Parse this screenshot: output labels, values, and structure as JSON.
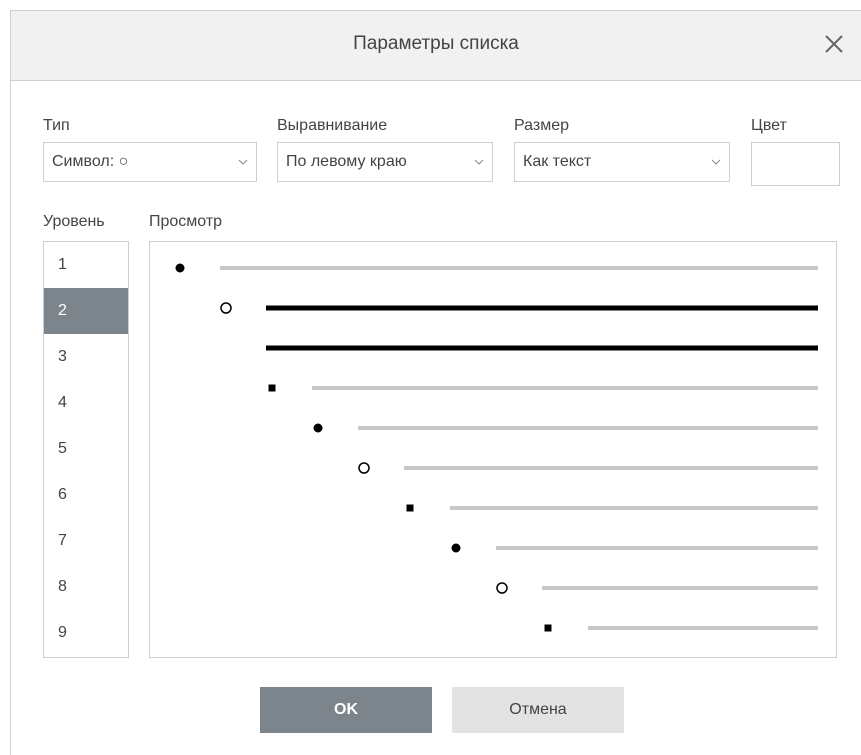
{
  "dialog": {
    "title": "Параметры списка"
  },
  "fields": {
    "type": {
      "label": "Тип",
      "value": "Символ: ○"
    },
    "alignment": {
      "label": "Выравнивание",
      "value": "По левому краю"
    },
    "size": {
      "label": "Размер",
      "value": "Как текст"
    },
    "color": {
      "label": "Цвет",
      "value": ""
    }
  },
  "levels": {
    "label": "Уровень",
    "items": [
      "1",
      "2",
      "3",
      "4",
      "5",
      "6",
      "7",
      "8",
      "9"
    ],
    "selected": "2"
  },
  "preview": {
    "label": "Просмотр",
    "bullets": [
      "filled-circle",
      "hollow-circle",
      "filled-square",
      "filled-circle",
      "hollow-circle",
      "filled-square",
      "filled-circle",
      "hollow-circle",
      "filled-square"
    ],
    "highlighted_level": 2
  },
  "buttons": {
    "ok": "OK",
    "cancel": "Отмена"
  },
  "colors": {
    "accent": "#7d858c",
    "border": "#cfcfcf",
    "line_gray": "#c8c8c8",
    "line_active": "#000000"
  }
}
